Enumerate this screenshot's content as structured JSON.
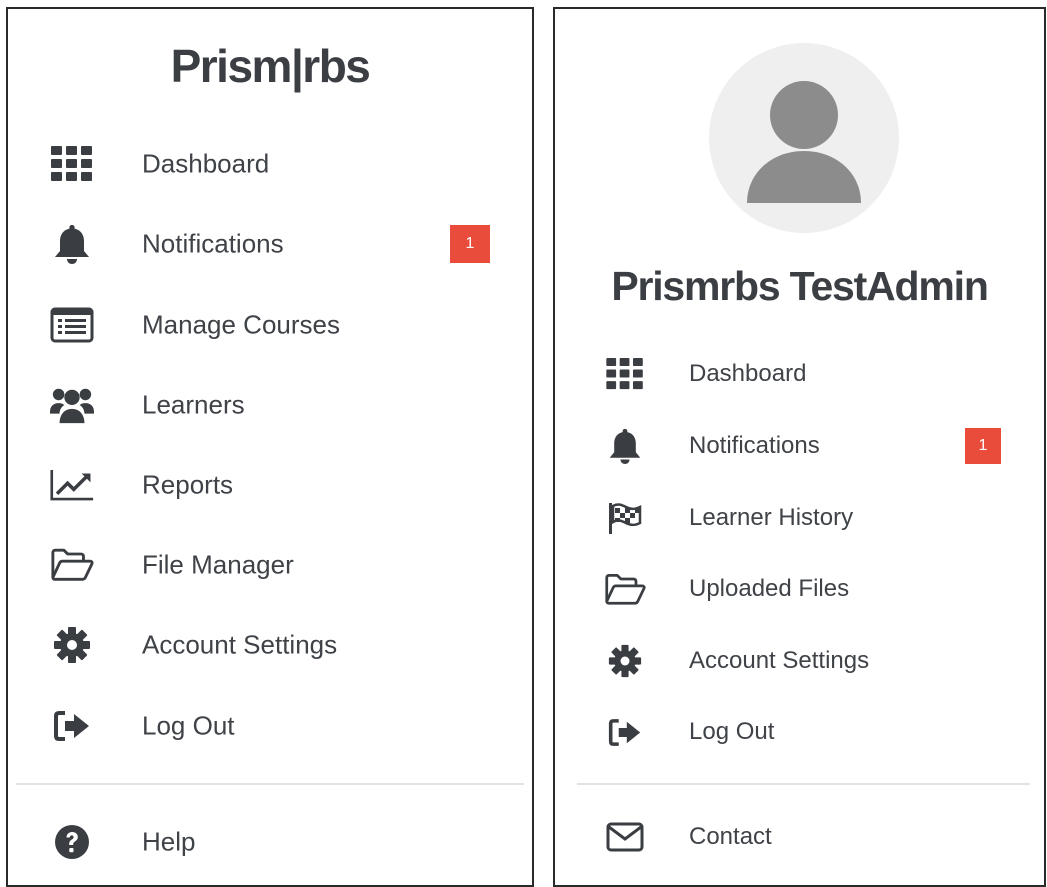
{
  "left_panel": {
    "brand": "Prism|rbs",
    "items": [
      {
        "label": "Dashboard",
        "icon": "grid-icon"
      },
      {
        "label": "Notifications",
        "icon": "bell-icon",
        "badge": "1"
      },
      {
        "label": "Manage Courses",
        "icon": "list-alt-icon"
      },
      {
        "label": "Learners",
        "icon": "users-icon"
      },
      {
        "label": "Reports",
        "icon": "line-chart-icon"
      },
      {
        "label": "File Manager",
        "icon": "folder-open-icon"
      },
      {
        "label": "Account Settings",
        "icon": "gear-icon"
      },
      {
        "label": "Log Out",
        "icon": "sign-out-icon"
      }
    ],
    "help": {
      "label": "Help",
      "icon": "question-circle-icon"
    }
  },
  "right_panel": {
    "user_name": "Prismrbs TestAdmin",
    "items": [
      {
        "label": "Dashboard",
        "icon": "grid-icon"
      },
      {
        "label": "Notifications",
        "icon": "bell-icon",
        "badge": "1"
      },
      {
        "label": "Learner History",
        "icon": "flag-checkered-icon"
      },
      {
        "label": "Uploaded Files",
        "icon": "folder-open-icon"
      },
      {
        "label": "Account Settings",
        "icon": "gear-icon"
      },
      {
        "label": "Log Out",
        "icon": "sign-out-icon"
      }
    ],
    "contact": {
      "label": "Contact",
      "icon": "envelope-icon"
    }
  },
  "colors": {
    "badge": "#ea4c3b",
    "icon": "#3a3d41",
    "text": "#3f4348",
    "border": "#2a2a2a",
    "avatar_bg": "#efefef",
    "avatar_fg": "#8c8c8c"
  }
}
